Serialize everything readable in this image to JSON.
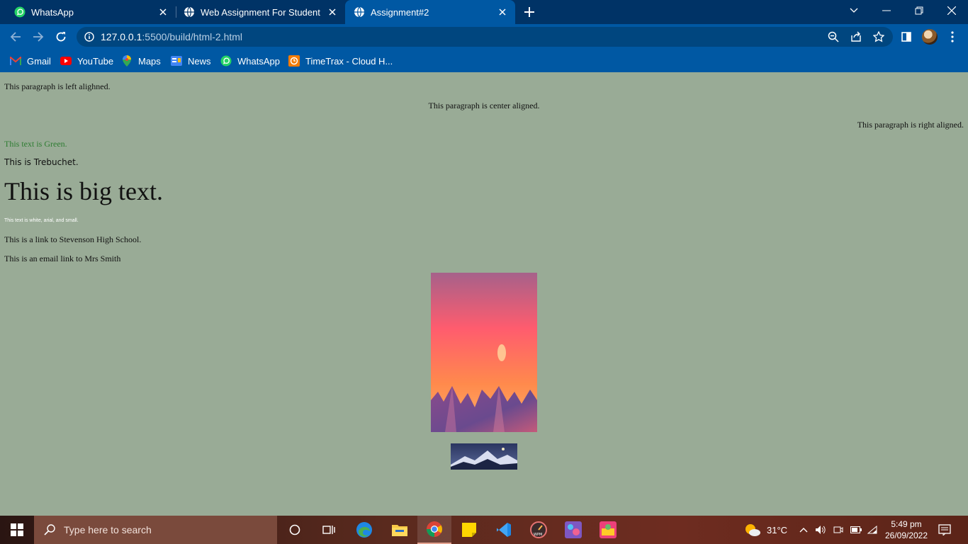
{
  "browser": {
    "tabs": [
      {
        "title": "WhatsApp",
        "icon": "whatsapp-icon",
        "active": false
      },
      {
        "title": "Web Assignment For Student",
        "icon": "globe-icon",
        "active": false
      },
      {
        "title": "Assignment#2",
        "icon": "globe-icon",
        "active": true
      }
    ],
    "url_host": "127.0.0.1",
    "url_rest": ":5500/build/html-2.html",
    "bookmarks": [
      {
        "label": "Gmail",
        "icon": "gmail-icon"
      },
      {
        "label": "YouTube",
        "icon": "youtube-icon"
      },
      {
        "label": "Maps",
        "icon": "maps-icon"
      },
      {
        "label": "News",
        "icon": "news-icon"
      },
      {
        "label": "WhatsApp",
        "icon": "whatsapp-icon"
      },
      {
        "label": "TimeTrax - Cloud H...",
        "icon": "timetrax-icon"
      }
    ]
  },
  "page": {
    "left_para": "This paragraph is left alighned.",
    "center_para": "This paragraph is center aligned.",
    "right_para": "This paragraph is right aligned.",
    "green_text": "This text is Green.",
    "trebuchet_text": "This is Trebuchet.",
    "big_text": "This is big text.",
    "small_white_text": "This text is white, arial, and small.",
    "link_text": "This is a link to Stevenson High School.",
    "email_text": "This is an email link to Mrs Smith",
    "colors": {
      "background": "#99ab96",
      "green": "#2e7d32"
    }
  },
  "taskbar": {
    "search_placeholder": "Type here to search",
    "weather": "31°C",
    "time": "5:49 pm",
    "date": "26/09/2022"
  }
}
